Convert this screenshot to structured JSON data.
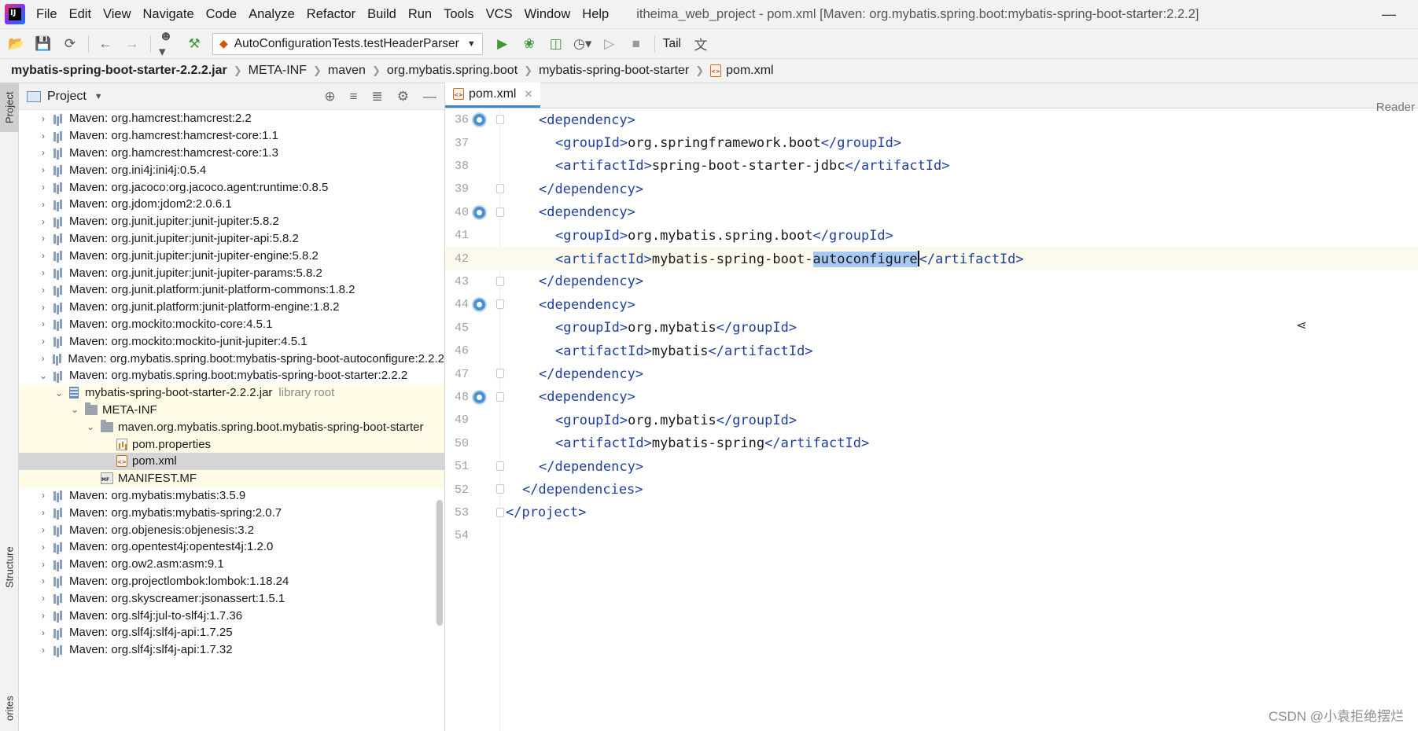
{
  "menubar": {
    "items": [
      "File",
      "Edit",
      "View",
      "Navigate",
      "Code",
      "Analyze",
      "Refactor",
      "Build",
      "Run",
      "Tools",
      "VCS",
      "Window",
      "Help"
    ],
    "window_title": "itheima_web_project - pom.xml [Maven: org.mybatis.spring.boot:mybatis-spring-boot-starter:2.2.2]",
    "minimize": "—"
  },
  "toolbar": {
    "run_config": "AutoConfigurationTests.testHeaderParser",
    "tail": "Tail"
  },
  "breadcrumb": [
    "mybatis-spring-boot-starter-2.2.2.jar",
    "META-INF",
    "maven",
    "org.mybatis.spring.boot",
    "mybatis-spring-boot-starter",
    "pom.xml"
  ],
  "left_strip": {
    "project_tab": "Project",
    "structure_tab": "Structure",
    "favorites_tab": "orites"
  },
  "project_panel": {
    "title": "Project",
    "rows": [
      {
        "label": "Maven: org.hamcrest:hamcrest:2.2",
        "depth": 0,
        "icon": "library-icon",
        "chev": "›"
      },
      {
        "label": "Maven: org.hamcrest:hamcrest-core:1.1",
        "depth": 0,
        "icon": "library-icon",
        "chev": "›"
      },
      {
        "label": "Maven: org.hamcrest:hamcrest-core:1.3",
        "depth": 0,
        "icon": "library-icon",
        "chev": "›"
      },
      {
        "label": "Maven: org.ini4j:ini4j:0.5.4",
        "depth": 0,
        "icon": "library-icon",
        "chev": "›"
      },
      {
        "label": "Maven: org.jacoco:org.jacoco.agent:runtime:0.8.5",
        "depth": 0,
        "icon": "library-icon",
        "chev": "›"
      },
      {
        "label": "Maven: org.jdom:jdom2:2.0.6.1",
        "depth": 0,
        "icon": "library-icon",
        "chev": "›"
      },
      {
        "label": "Maven: org.junit.jupiter:junit-jupiter:5.8.2",
        "depth": 0,
        "icon": "library-icon",
        "chev": "›"
      },
      {
        "label": "Maven: org.junit.jupiter:junit-jupiter-api:5.8.2",
        "depth": 0,
        "icon": "library-icon",
        "chev": "›"
      },
      {
        "label": "Maven: org.junit.jupiter:junit-jupiter-engine:5.8.2",
        "depth": 0,
        "icon": "library-icon",
        "chev": "›"
      },
      {
        "label": "Maven: org.junit.jupiter:junit-jupiter-params:5.8.2",
        "depth": 0,
        "icon": "library-icon",
        "chev": "›"
      },
      {
        "label": "Maven: org.junit.platform:junit-platform-commons:1.8.2",
        "depth": 0,
        "icon": "library-icon",
        "chev": "›"
      },
      {
        "label": "Maven: org.junit.platform:junit-platform-engine:1.8.2",
        "depth": 0,
        "icon": "library-icon",
        "chev": "›"
      },
      {
        "label": "Maven: org.mockito:mockito-core:4.5.1",
        "depth": 0,
        "icon": "library-icon",
        "chev": "›"
      },
      {
        "label": "Maven: org.mockito:mockito-junit-jupiter:4.5.1",
        "depth": 0,
        "icon": "library-icon",
        "chev": "›"
      },
      {
        "label": "Maven: org.mybatis.spring.boot:mybatis-spring-boot-autoconfigure:2.2.2",
        "depth": 0,
        "icon": "library-icon",
        "chev": "›"
      },
      {
        "label": "Maven: org.mybatis.spring.boot:mybatis-spring-boot-starter:2.2.2",
        "depth": 0,
        "icon": "library-icon",
        "chev": "⌄"
      },
      {
        "label": "mybatis-spring-boot-starter-2.2.2.jar",
        "hint": "library root",
        "depth": 1,
        "icon": "jar-icon",
        "chev": "⌄",
        "lib": true
      },
      {
        "label": "META-INF",
        "depth": 2,
        "icon": "folder-icon",
        "chev": "⌄",
        "lib": true
      },
      {
        "label": "maven.org.mybatis.spring.boot.mybatis-spring-boot-starter",
        "depth": 3,
        "icon": "folder-icon",
        "chev": "⌄",
        "lib": true
      },
      {
        "label": "pom.properties",
        "depth": 4,
        "icon": "properties-file-icon",
        "chev": "",
        "lib": true
      },
      {
        "label": "pom.xml",
        "depth": 4,
        "icon": "xml-file-icon",
        "chev": "",
        "selected": true
      },
      {
        "label": "MANIFEST.MF",
        "depth": 3,
        "icon": "manifest-file-icon",
        "chev": "",
        "lib": true
      },
      {
        "label": "Maven: org.mybatis:mybatis:3.5.9",
        "depth": 0,
        "icon": "library-icon",
        "chev": "›"
      },
      {
        "label": "Maven: org.mybatis:mybatis-spring:2.0.7",
        "depth": 0,
        "icon": "library-icon",
        "chev": "›"
      },
      {
        "label": "Maven: org.objenesis:objenesis:3.2",
        "depth": 0,
        "icon": "library-icon",
        "chev": "›"
      },
      {
        "label": "Maven: org.opentest4j:opentest4j:1.2.0",
        "depth": 0,
        "icon": "library-icon",
        "chev": "›"
      },
      {
        "label": "Maven: org.ow2.asm:asm:9.1",
        "depth": 0,
        "icon": "library-icon",
        "chev": "›"
      },
      {
        "label": "Maven: org.projectlombok:lombok:1.18.24",
        "depth": 0,
        "icon": "library-icon",
        "chev": "›"
      },
      {
        "label": "Maven: org.skyscreamer:jsonassert:1.5.1",
        "depth": 0,
        "icon": "library-icon",
        "chev": "›"
      },
      {
        "label": "Maven: org.slf4j:jul-to-slf4j:1.7.36",
        "depth": 0,
        "icon": "library-icon",
        "chev": "›"
      },
      {
        "label": "Maven: org.slf4j:slf4j-api:1.7.25",
        "depth": 0,
        "icon": "library-icon",
        "chev": "›"
      },
      {
        "label": "Maven: org.slf4j:slf4j-api:1.7.32",
        "depth": 0,
        "icon": "library-icon",
        "chev": "›"
      }
    ]
  },
  "editor": {
    "tab_label": "pom.xml",
    "tab_close": "✕",
    "reader_mode": "Reader",
    "lines": [
      {
        "n": "36",
        "indent": 2,
        "parts": [
          [
            "tag",
            "<dependency>"
          ]
        ],
        "mark": true,
        "fold": true
      },
      {
        "n": "37",
        "indent": 3,
        "parts": [
          [
            "tag",
            "<groupId>"
          ],
          [
            "txt",
            "org.springframework.boot"
          ],
          [
            "tag",
            "</groupId>"
          ]
        ]
      },
      {
        "n": "38",
        "indent": 3,
        "parts": [
          [
            "tag",
            "<artifactId>"
          ],
          [
            "txt",
            "spring-boot-starter-jdbc"
          ],
          [
            "tag",
            "</artifactId>"
          ]
        ]
      },
      {
        "n": "39",
        "indent": 2,
        "parts": [
          [
            "tag",
            "</dependency>"
          ]
        ],
        "fold": true
      },
      {
        "n": "40",
        "indent": 2,
        "parts": [
          [
            "tag",
            "<dependency>"
          ]
        ],
        "mark": true,
        "fold": true
      },
      {
        "n": "41",
        "indent": 3,
        "parts": [
          [
            "tag",
            "<groupId>"
          ],
          [
            "txt",
            "org.mybatis.spring.boot"
          ],
          [
            "tag",
            "</groupId>"
          ]
        ]
      },
      {
        "n": "42",
        "indent": 3,
        "parts": [
          [
            "tag",
            "<artifactId>"
          ],
          [
            "txt",
            "mybatis-spring-boot-"
          ],
          [
            "sel",
            "autoconfigure"
          ],
          [
            "caret",
            ""
          ],
          [
            "tag",
            "</artifactId>"
          ]
        ],
        "current": true
      },
      {
        "n": "43",
        "indent": 2,
        "parts": [
          [
            "tag",
            "</dependency>"
          ]
        ],
        "fold": true
      },
      {
        "n": "44",
        "indent": 2,
        "parts": [
          [
            "tag",
            "<dependency>"
          ]
        ],
        "mark": true,
        "fold": true
      },
      {
        "n": "45",
        "indent": 3,
        "parts": [
          [
            "tag",
            "<groupId>"
          ],
          [
            "txt",
            "org.mybatis"
          ],
          [
            "tag",
            "</groupId>"
          ]
        ]
      },
      {
        "n": "46",
        "indent": 3,
        "parts": [
          [
            "tag",
            "<artifactId>"
          ],
          [
            "txt",
            "mybatis"
          ],
          [
            "tag",
            "</artifactId>"
          ]
        ]
      },
      {
        "n": "47",
        "indent": 2,
        "parts": [
          [
            "tag",
            "</dependency>"
          ]
        ],
        "fold": true
      },
      {
        "n": "48",
        "indent": 2,
        "parts": [
          [
            "tag",
            "<dependency>"
          ]
        ],
        "mark": true,
        "fold": true
      },
      {
        "n": "49",
        "indent": 3,
        "parts": [
          [
            "tag",
            "<groupId>"
          ],
          [
            "txt",
            "org.mybatis"
          ],
          [
            "tag",
            "</groupId>"
          ]
        ]
      },
      {
        "n": "50",
        "indent": 3,
        "parts": [
          [
            "tag",
            "<artifactId>"
          ],
          [
            "txt",
            "mybatis-spring"
          ],
          [
            "tag",
            "</artifactId>"
          ]
        ]
      },
      {
        "n": "51",
        "indent": 2,
        "parts": [
          [
            "tag",
            "</dependency>"
          ]
        ],
        "fold": true
      },
      {
        "n": "52",
        "indent": 1,
        "parts": [
          [
            "tag",
            "</dependencies>"
          ]
        ],
        "fold": true
      },
      {
        "n": "53",
        "indent": 0,
        "parts": [
          [
            "tag",
            "</project>"
          ]
        ],
        "fold": true
      },
      {
        "n": "54",
        "indent": 0,
        "parts": []
      }
    ]
  },
  "watermark": "CSDN @小袁拒绝摆烂",
  "colors": {
    "tag": "#1f3fa1",
    "selection": "#a6c8f2",
    "library_bg": "#fffbe6",
    "selected_row": "#d5d5d5",
    "run_green": "#3d9a35"
  }
}
